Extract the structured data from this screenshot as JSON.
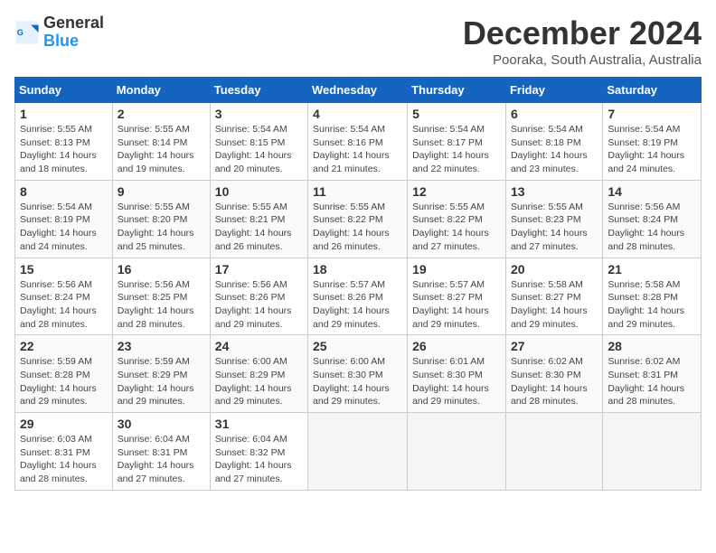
{
  "logo": {
    "text_general": "General",
    "text_blue": "Blue"
  },
  "header": {
    "month": "December 2024",
    "location": "Pooraka, South Australia, Australia"
  },
  "columns": [
    "Sunday",
    "Monday",
    "Tuesday",
    "Wednesday",
    "Thursday",
    "Friday",
    "Saturday"
  ],
  "weeks": [
    [
      {
        "day": "1",
        "sunrise": "5:55 AM",
        "sunset": "8:13 PM",
        "daylight": "14 hours and 18 minutes."
      },
      {
        "day": "2",
        "sunrise": "5:55 AM",
        "sunset": "8:14 PM",
        "daylight": "14 hours and 19 minutes."
      },
      {
        "day": "3",
        "sunrise": "5:54 AM",
        "sunset": "8:15 PM",
        "daylight": "14 hours and 20 minutes."
      },
      {
        "day": "4",
        "sunrise": "5:54 AM",
        "sunset": "8:16 PM",
        "daylight": "14 hours and 21 minutes."
      },
      {
        "day": "5",
        "sunrise": "5:54 AM",
        "sunset": "8:17 PM",
        "daylight": "14 hours and 22 minutes."
      },
      {
        "day": "6",
        "sunrise": "5:54 AM",
        "sunset": "8:18 PM",
        "daylight": "14 hours and 23 minutes."
      },
      {
        "day": "7",
        "sunrise": "5:54 AM",
        "sunset": "8:19 PM",
        "daylight": "14 hours and 24 minutes."
      }
    ],
    [
      {
        "day": "8",
        "sunrise": "5:54 AM",
        "sunset": "8:19 PM",
        "daylight": "14 hours and 24 minutes."
      },
      {
        "day": "9",
        "sunrise": "5:55 AM",
        "sunset": "8:20 PM",
        "daylight": "14 hours and 25 minutes."
      },
      {
        "day": "10",
        "sunrise": "5:55 AM",
        "sunset": "8:21 PM",
        "daylight": "14 hours and 26 minutes."
      },
      {
        "day": "11",
        "sunrise": "5:55 AM",
        "sunset": "8:22 PM",
        "daylight": "14 hours and 26 minutes."
      },
      {
        "day": "12",
        "sunrise": "5:55 AM",
        "sunset": "8:22 PM",
        "daylight": "14 hours and 27 minutes."
      },
      {
        "day": "13",
        "sunrise": "5:55 AM",
        "sunset": "8:23 PM",
        "daylight": "14 hours and 27 minutes."
      },
      {
        "day": "14",
        "sunrise": "5:56 AM",
        "sunset": "8:24 PM",
        "daylight": "14 hours and 28 minutes."
      }
    ],
    [
      {
        "day": "15",
        "sunrise": "5:56 AM",
        "sunset": "8:24 PM",
        "daylight": "14 hours and 28 minutes."
      },
      {
        "day": "16",
        "sunrise": "5:56 AM",
        "sunset": "8:25 PM",
        "daylight": "14 hours and 28 minutes."
      },
      {
        "day": "17",
        "sunrise": "5:56 AM",
        "sunset": "8:26 PM",
        "daylight": "14 hours and 29 minutes."
      },
      {
        "day": "18",
        "sunrise": "5:57 AM",
        "sunset": "8:26 PM",
        "daylight": "14 hours and 29 minutes."
      },
      {
        "day": "19",
        "sunrise": "5:57 AM",
        "sunset": "8:27 PM",
        "daylight": "14 hours and 29 minutes."
      },
      {
        "day": "20",
        "sunrise": "5:58 AM",
        "sunset": "8:27 PM",
        "daylight": "14 hours and 29 minutes."
      },
      {
        "day": "21",
        "sunrise": "5:58 AM",
        "sunset": "8:28 PM",
        "daylight": "14 hours and 29 minutes."
      }
    ],
    [
      {
        "day": "22",
        "sunrise": "5:59 AM",
        "sunset": "8:28 PM",
        "daylight": "14 hours and 29 minutes."
      },
      {
        "day": "23",
        "sunrise": "5:59 AM",
        "sunset": "8:29 PM",
        "daylight": "14 hours and 29 minutes."
      },
      {
        "day": "24",
        "sunrise": "6:00 AM",
        "sunset": "8:29 PM",
        "daylight": "14 hours and 29 minutes."
      },
      {
        "day": "25",
        "sunrise": "6:00 AM",
        "sunset": "8:30 PM",
        "daylight": "14 hours and 29 minutes."
      },
      {
        "day": "26",
        "sunrise": "6:01 AM",
        "sunset": "8:30 PM",
        "daylight": "14 hours and 29 minutes."
      },
      {
        "day": "27",
        "sunrise": "6:02 AM",
        "sunset": "8:30 PM",
        "daylight": "14 hours and 28 minutes."
      },
      {
        "day": "28",
        "sunrise": "6:02 AM",
        "sunset": "8:31 PM",
        "daylight": "14 hours and 28 minutes."
      }
    ],
    [
      {
        "day": "29",
        "sunrise": "6:03 AM",
        "sunset": "8:31 PM",
        "daylight": "14 hours and 28 minutes."
      },
      {
        "day": "30",
        "sunrise": "6:04 AM",
        "sunset": "8:31 PM",
        "daylight": "14 hours and 27 minutes."
      },
      {
        "day": "31",
        "sunrise": "6:04 AM",
        "sunset": "8:32 PM",
        "daylight": "14 hours and 27 minutes."
      },
      null,
      null,
      null,
      null
    ]
  ]
}
